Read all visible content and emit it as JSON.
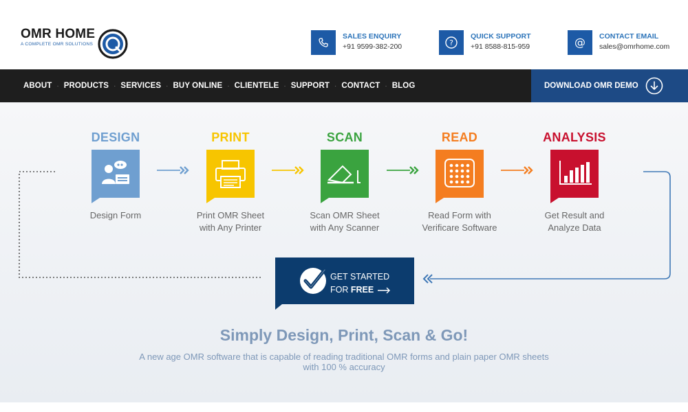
{
  "header": {
    "logo_title": "OMR HOME",
    "logo_subtitle": "A COMPLETE OMR SOLUTIONS",
    "contacts": [
      {
        "label": "SALES ENQUIRY",
        "value": "+91 9599-382-200",
        "icon": "phone-icon"
      },
      {
        "label": "QUICK SUPPORT",
        "value": "+91  8588-815-959",
        "icon": "question-icon"
      },
      {
        "label": "CONTACT EMAIL",
        "value": "sales@omrhome.com",
        "icon": "at-icon"
      }
    ]
  },
  "nav": {
    "items": [
      "ABOUT",
      "PRODUCTS",
      "SERVICES",
      "BUY ONLINE",
      "CLIENTELE",
      "SUPPORT",
      "CONTACT",
      "BLOG"
    ],
    "demo_button": "DOWNLOAD OMR DEMO"
  },
  "steps": [
    {
      "title": "DESIGN",
      "desc": "Design Form",
      "color": "#6f9fd0",
      "icon": "designer-icon"
    },
    {
      "title": "PRINT",
      "desc": "Print OMR Sheet with Any Printer",
      "color": "#f7c500",
      "icon": "printer-icon"
    },
    {
      "title": "SCAN",
      "desc": "Scan OMR Sheet with Any Scanner",
      "color": "#3aa33f",
      "icon": "scanner-icon"
    },
    {
      "title": "READ",
      "desc": "Read Form with Verificare Software",
      "color": "#f47d20",
      "icon": "omr-grid-icon"
    },
    {
      "title": "ANALYSIS",
      "desc": "Get Result and Analyze Data",
      "color": "#c8102e",
      "icon": "bar-chart-icon"
    }
  ],
  "cta": {
    "line1": "GET STARTED",
    "line2_prefix": "FOR ",
    "line2_bold": "FREE",
    "color": "#0c3c6e"
  },
  "headline": "Simply Design, Print, Scan & Go!",
  "subtext": "A new age OMR software that is capable of reading traditional OMR forms and plain paper OMR sheets with 100 % accuracy"
}
